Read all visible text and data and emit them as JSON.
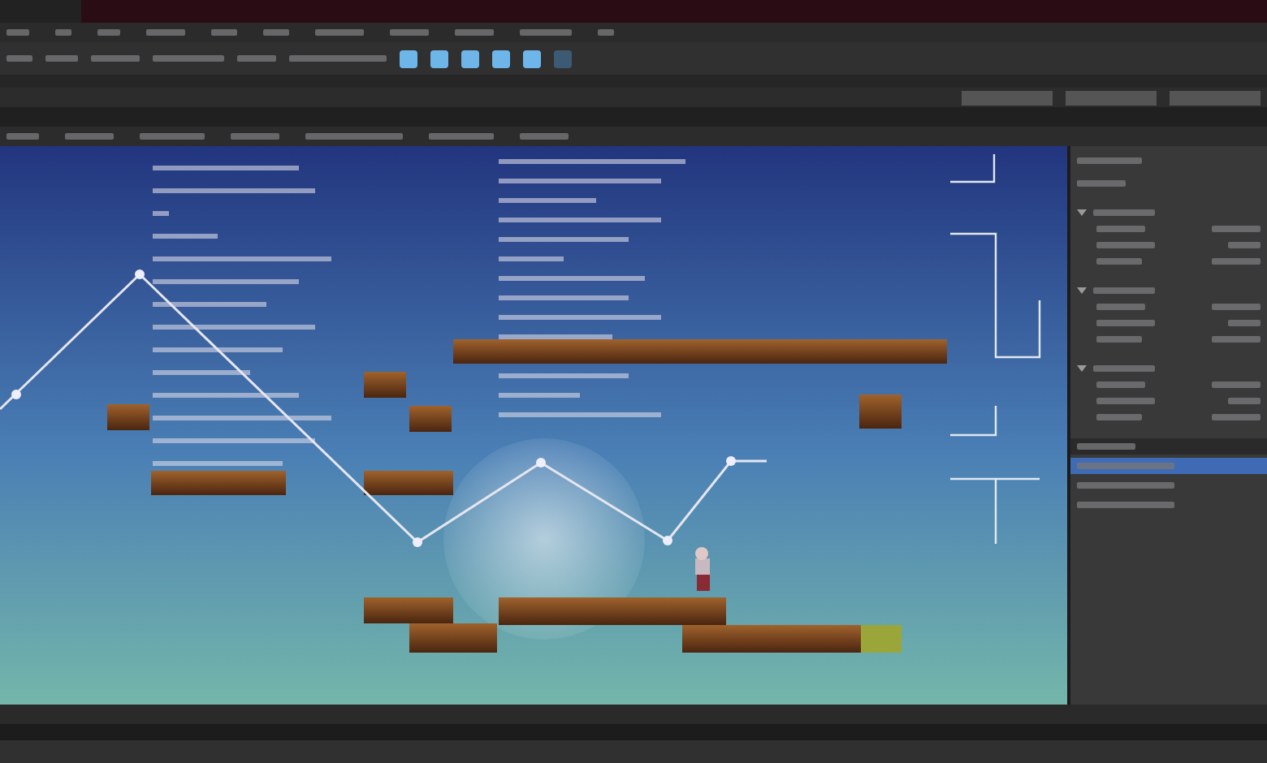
{
  "toolbar": {
    "tools": [
      {
        "on": true
      },
      {
        "on": true
      },
      {
        "on": true
      },
      {
        "on": true
      },
      {
        "on": true
      },
      {
        "on": false
      }
    ]
  },
  "inspector": {
    "sections": [
      {
        "expanded": true
      },
      {
        "expanded": true
      },
      {
        "expanded": true
      }
    ]
  },
  "hierarchy": {
    "rows": [
      {
        "selected": true
      },
      {
        "selected": false
      },
      {
        "selected": false
      }
    ]
  }
}
